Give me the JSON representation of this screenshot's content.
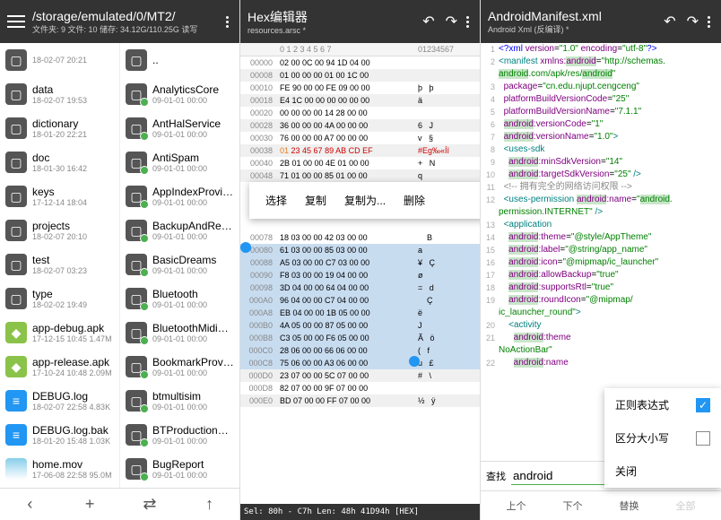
{
  "panel1": {
    "path": "/storage/emulated/0/MT2/",
    "stats": "文件夹: 9  文件: 10  储存: 34.12G/110.25G  读写",
    "left_files": [
      {
        "name": "",
        "meta": "18-02-07 20:21",
        "type": "folder"
      },
      {
        "name": "data",
        "meta": "18-02-07 19:53",
        "type": "folder"
      },
      {
        "name": "dictionary",
        "meta": "18-01-20 22:21",
        "type": "folder"
      },
      {
        "name": "doc",
        "meta": "18-01-30 16:42",
        "type": "folder"
      },
      {
        "name": "keys",
        "meta": "17-12-14 18:04",
        "type": "folder"
      },
      {
        "name": "projects",
        "meta": "18-02-07 20:10",
        "type": "folder"
      },
      {
        "name": "test",
        "meta": "18-02-07 03:23",
        "type": "folder"
      },
      {
        "name": "type",
        "meta": "18-02-02 19:49",
        "type": "folder"
      },
      {
        "name": "app-debug.apk",
        "meta": "17-12-15 10:45  1.47M",
        "type": "apk"
      },
      {
        "name": "app-release.apk",
        "meta": "17-10-24 10:48  2.09M",
        "type": "apk"
      },
      {
        "name": "DEBUG.log",
        "meta": "18-02-07 22:58  4.83K",
        "type": "doc"
      },
      {
        "name": "DEBUG.log.bak",
        "meta": "18-01-20 15:48  1.03K",
        "type": "doc"
      },
      {
        "name": "home.mov",
        "meta": "17-06-08 22:58  95.0M",
        "type": "img"
      }
    ],
    "right_files": [
      {
        "name": "..",
        "meta": "",
        "type": "folder"
      },
      {
        "name": "AnalyticsCore",
        "meta": "09-01-01 00:00",
        "type": "folder",
        "badge": true
      },
      {
        "name": "AntHalService",
        "meta": "09-01-01 00:00",
        "type": "folder",
        "badge": true
      },
      {
        "name": "AntiSpam",
        "meta": "09-01-01 00:00",
        "type": "folder",
        "badge": true
      },
      {
        "name": "AppIndexProvider",
        "meta": "09-01-01 00:00",
        "type": "folder",
        "badge": true
      },
      {
        "name": "BackupAndRestore",
        "meta": "09-01-01 00:00",
        "type": "folder",
        "badge": true
      },
      {
        "name": "BasicDreams",
        "meta": "09-01-01 00:00",
        "type": "folder",
        "badge": true
      },
      {
        "name": "Bluetooth",
        "meta": "09-01-01 00:00",
        "type": "folder",
        "badge": true
      },
      {
        "name": "BluetoothMidiService",
        "meta": "09-01-01 00:00",
        "type": "folder",
        "badge": true
      },
      {
        "name": "BookmarkProvider",
        "meta": "09-01-01 00:00",
        "type": "folder",
        "badge": true
      },
      {
        "name": "btmultisim",
        "meta": "09-01-01 00:00",
        "type": "folder",
        "badge": true
      },
      {
        "name": "BTProductionLineTool",
        "meta": "09-01-01 00:00",
        "type": "folder",
        "badge": true
      },
      {
        "name": "BugReport",
        "meta": "09-01-01 00:00",
        "type": "folder",
        "badge": true
      }
    ],
    "bottom_icons": [
      "‹",
      "+",
      "⇄",
      "↑"
    ]
  },
  "panel2": {
    "title": "Hex编辑器",
    "subtitle": "resources.arsc *",
    "ruler_bytes": "0  1  2  3  4  5  6  7",
    "ruler_ascii": "01234567",
    "rows": [
      {
        "off": "00000",
        "b": "02 00 0C 00 94 1D 04 00",
        "a": "       ",
        "sel": false
      },
      {
        "off": "00008",
        "b": "01 00 00 00 01 00 1C 00",
        "a": "        ",
        "sel": false
      },
      {
        "off": "00010",
        "b": "FE 90 00 00 FE 09 00 00",
        "a": "þ   þ   ",
        "sel": false
      },
      {
        "off": "00018",
        "b": "E4 1C 00 00 00 00 00 00",
        "a": "ä       ",
        "sel": false
      },
      {
        "off": "00020",
        "b": "00 00 00 00 14 28 00 00",
        "a": "        ",
        "sel": false
      },
      {
        "off": "00028",
        "b": "36 00 00 00 4A 00 00 00",
        "a": "6   J   ",
        "sel": false
      },
      {
        "off": "00030",
        "b": "76 00 00 00 A7 00 00 00",
        "a": "v   §   ",
        "sel": false
      },
      {
        "off": "00038",
        "b": "01 23 45 67 89 AB CD EF",
        "a": "#Eg‰«Íï",
        "sel": false,
        "red": true
      },
      {
        "off": "00040",
        "b": "2B 01 00 00 4E 01 00 00",
        "a": "+   N   ",
        "sel": false
      },
      {
        "off": "00048",
        "b": "71 01 00 00 85 01 00 00",
        "a": "q       ",
        "sel": false
      },
      {
        "off": "",
        "b": "",
        "a": "",
        "menu": true
      },
      {
        "off": "",
        "b": "",
        "a": "",
        "sel": false
      },
      {
        "off": "00078",
        "b": "18 03 00 00 42 03 00 00",
        "a": "    B   ",
        "sel": false
      },
      {
        "off": "00080",
        "b": "61 03 00 00 85 03 00 00",
        "a": "a       ",
        "sel": true
      },
      {
        "off": "00088",
        "b": "A5 03 00 00 C7 03 00 00",
        "a": "¥   Ç   ",
        "sel": true
      },
      {
        "off": "00090",
        "b": "F8 03 00 00 19 04 00 00",
        "a": "ø       ",
        "sel": true
      },
      {
        "off": "00098",
        "b": "3D 04 00 00 64 04 00 00",
        "a": "=   d   ",
        "sel": true
      },
      {
        "off": "000A0",
        "b": "96 04 00 00 C7 04 00 00",
        "a": "    Ç   ",
        "sel": true
      },
      {
        "off": "000A8",
        "b": "EB 04 00 00 1B 05 00 00",
        "a": "ë       ",
        "sel": true
      },
      {
        "off": "000B0",
        "b": "4A 05 00 00 87 05 00 00",
        "a": "J       ",
        "sel": true
      },
      {
        "off": "000B8",
        "b": "C3 05 00 00 F6 05 00 00",
        "a": "Ã   ö   ",
        "sel": true
      },
      {
        "off": "000C0",
        "b": "28 06 00 00 66 06 00 00",
        "a": "(   f   ",
        "sel": true
      },
      {
        "off": "000C8",
        "b": "75 06 00 00 A3 06 00 00",
        "a": "u   £   ",
        "sel": true
      },
      {
        "off": "000D0",
        "b": "23 07 00 00 5C 07 00 00",
        "a": "#   \\   ",
        "sel": false
      },
      {
        "off": "000D8",
        "b": "82 07 00 00 9F 07 00 00",
        "a": "        ",
        "sel": false
      },
      {
        "off": "000E0",
        "b": "BD 07 00 00 FF 07 00 00",
        "a": "½   ÿ   ",
        "sel": false
      }
    ],
    "context_menu": [
      "选择",
      "复制",
      "复制为...",
      "删除"
    ],
    "status": "Sel: 80h - C7h    Len: 48h    41D94h  [HEX]"
  },
  "panel3": {
    "title": "AndroidManifest.xml",
    "subtitle": "Android Xml (反编译) *",
    "lines": [
      {
        "n": 1,
        "html": "<span class='c-decl'>&lt;?xml</span> <span class='c-attr'>version</span>=<span class='c-str'>\"1.0\"</span> <span class='c-attr'>encoding</span>=<span class='c-str'>\"utf-8\"</span><span class='c-decl'>?&gt;</span>"
      },
      {
        "n": 2,
        "html": "<span class='c-tag'>&lt;manifest</span> <span class='c-attr'>xmlns:<span class='hl'>android</span></span>=<span class='c-str'>\"http://schemas.</span>"
      },
      {
        "n": "",
        "html": "<span class='c-str'><span class='hl'>android</span>.com/apk/res/<span class='hl'>android</span>\"</span>"
      },
      {
        "n": 3,
        "html": "  <span class='c-attr'>package</span>=<span class='c-str'>\"cn.edu.njupt.cengceng\"</span>"
      },
      {
        "n": 4,
        "html": "  <span class='c-attr'>platformBuildVersionCode</span>=<span class='c-str'>\"25\"</span>"
      },
      {
        "n": 5,
        "html": "  <span class='c-attr'>platformBuildVersionName</span>=<span class='c-str'>\"7.1.1\"</span>"
      },
      {
        "n": 6,
        "html": "  <span class='c-attr'><span class='hl'>android</span>:versionCode</span>=<span class='c-str'>\"1\"</span>"
      },
      {
        "n": 7,
        "html": "  <span class='c-attr'><span class='hl'>android</span>:versionName</span>=<span class='c-str'>\"1.0\"</span><span class='c-tag'>&gt;</span>"
      },
      {
        "n": 8,
        "html": "  <span class='c-tag'>&lt;uses-sdk</span>"
      },
      {
        "n": 9,
        "html": "    <span class='c-attr'><span class='hl'>android</span>:minSdkVersion</span>=<span class='c-str'>\"14\"</span>"
      },
      {
        "n": 10,
        "html": "    <span class='c-attr'><span class='hl'>android</span>:targetSdkVersion</span>=<span class='c-str'>\"25\"</span> <span class='c-tag'>/&gt;</span>"
      },
      {
        "n": 11,
        "html": "  <span class='c-comment'>&lt;!-- 拥有完全的网络访问权限 --&gt;</span>"
      },
      {
        "n": 12,
        "html": "  <span class='c-tag'>&lt;uses-permission</span> <span class='c-attr'><span class='hl'>android</span>:name</span>=<span class='c-str'>\"<span class='hl'>android</span>.</span>"
      },
      {
        "n": "",
        "html": "<span class='c-str'>permission.INTERNET\"</span> <span class='c-tag'>/&gt;</span>"
      },
      {
        "n": 13,
        "html": "  <span class='c-tag'>&lt;application</span>"
      },
      {
        "n": 14,
        "html": "    <span class='c-attr'><span class='hl'>android</span>:theme</span>=<span class='c-str'>\"@style/AppTheme\"</span>"
      },
      {
        "n": 15,
        "html": "    <span class='c-attr'><span class='hl'>android</span>:label</span>=<span class='c-str'>\"@string/app_name\"</span>"
      },
      {
        "n": 16,
        "html": "    <span class='c-attr'><span class='hl'>android</span>:icon</span>=<span class='c-str'>\"@mipmap/ic_launcher\"</span>"
      },
      {
        "n": 17,
        "html": "    <span class='c-attr'><span class='hl'>android</span>:allowBackup</span>=<span class='c-str'>\"true\"</span>"
      },
      {
        "n": 18,
        "html": "    <span class='c-attr'><span class='hl'>android</span>:supportsRtl</span>=<span class='c-str'>\"true\"</span>"
      },
      {
        "n": 19,
        "html": "    <span class='c-attr'><span class='hl'>android</span>:roundIcon</span>=<span class='c-str'>\"@mipmap/</span>"
      },
      {
        "n": "",
        "html": "<span class='c-str'>ic_launcher_round\"</span><span class='c-tag'>&gt;</span>"
      },
      {
        "n": 20,
        "html": "    <span class='c-tag'>&lt;activity</span>"
      },
      {
        "n": 21,
        "html": "      <span class='c-attr'><span class='hl'>android</span>:theme</span>"
      },
      {
        "n": "",
        "html": "<span class='c-str'>NoActionBar\"</span>"
      },
      {
        "n": 22,
        "html": "      <span class='c-attr'><span class='hl'>android</span>:name</span>"
      }
    ],
    "popup": [
      {
        "label": "正则表达式",
        "checked": true
      },
      {
        "label": "区分大小写",
        "checked": false
      },
      {
        "label": "关闭",
        "checked": null
      }
    ],
    "search_label": "查找",
    "search_value": "android",
    "nav": [
      "上个",
      "下个",
      "替换",
      "全部"
    ]
  }
}
